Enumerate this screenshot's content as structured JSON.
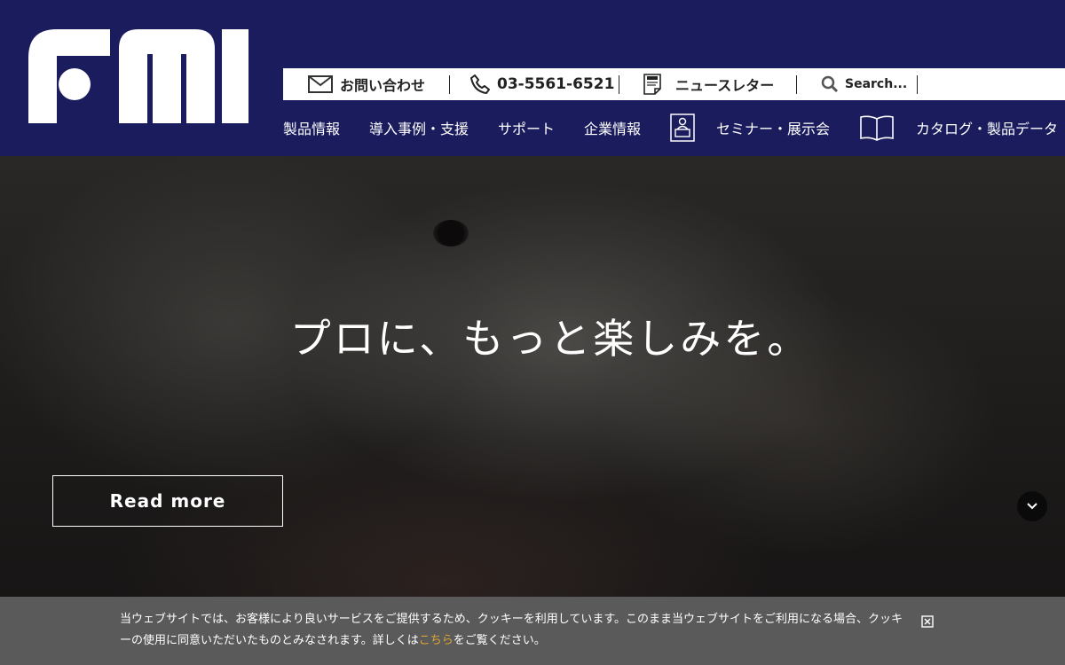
{
  "brand": {
    "logo_text": "fmi",
    "header_color": "#1b1c5e"
  },
  "utility_bar": {
    "contact_label": "お問い合わせ",
    "phone": "03-5561-6521",
    "newsletter_label": "ニュースレター",
    "search_placeholder": "Search..."
  },
  "nav": {
    "items": [
      "製品情報",
      "導入事例・支援",
      "サポート",
      "企業情報"
    ],
    "seminar_label": "セミナー・展示会",
    "catalog_label": "カタログ・製品データ"
  },
  "hero": {
    "tagline": "プロに、もっと楽しみを。",
    "read_more_label": "Read more"
  },
  "cookie_banner": {
    "text_before_link": "当ウェブサイトでは、お客様により良いサービスをご提供するため、クッキーを利用しています。このまま当ウェブサイトをご利用になる場合、クッキーの使用に同意いただいたものとみなされます。詳しくは",
    "link_label": "こちら",
    "text_after_link": "をご覧ください。",
    "link_color": "#e0a830"
  }
}
